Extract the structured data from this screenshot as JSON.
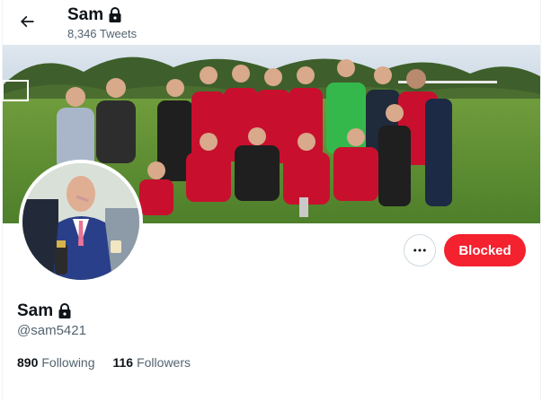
{
  "header": {
    "name": "Sam",
    "tweet_count": "8,346 Tweets"
  },
  "profile": {
    "display_name": "Sam",
    "handle": "@sam5421",
    "following_count": "890",
    "following_label": "Following",
    "followers_count": "116",
    "followers_label": "Followers"
  },
  "actions": {
    "blocked_label": "Blocked",
    "more_icon": "more-horizontal-icon"
  },
  "icons": {
    "back": "arrow-left-icon",
    "protected": "lock-icon"
  },
  "colors": {
    "blocked_button": "#f4212e",
    "secondary_text": "#536471",
    "primary_text": "#0f1419"
  }
}
